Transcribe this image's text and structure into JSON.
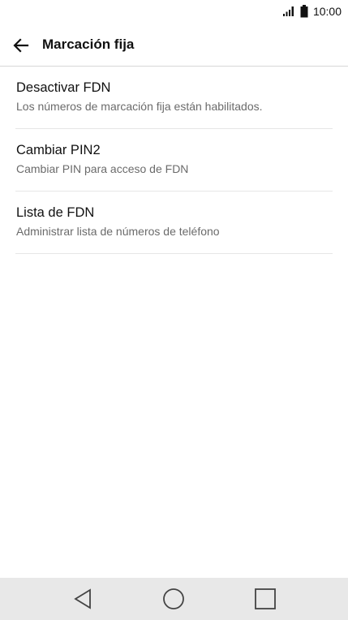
{
  "status_bar": {
    "time": "10:00",
    "icons": [
      "signal-icon",
      "battery-icon"
    ]
  },
  "app_bar": {
    "back_icon": "arrow-left-icon",
    "title": "Marcación fija"
  },
  "settings": {
    "items": [
      {
        "title": "Desactivar FDN",
        "subtitle": "Los números de marcación fija están habilitados."
      },
      {
        "title": "Cambiar PIN2",
        "subtitle": "Cambiar PIN para acceso de FDN"
      },
      {
        "title": "Lista de FDN",
        "subtitle": "Administrar lista de números de teléfono"
      }
    ]
  },
  "nav_bar": {
    "icons": [
      "nav-back-icon",
      "nav-home-icon",
      "nav-recents-icon"
    ]
  },
  "colors": {
    "text_primary": "#111111",
    "text_secondary": "#6b6b6b",
    "divider": "#e6e6e6",
    "nav_background": "#e8e8e8"
  }
}
